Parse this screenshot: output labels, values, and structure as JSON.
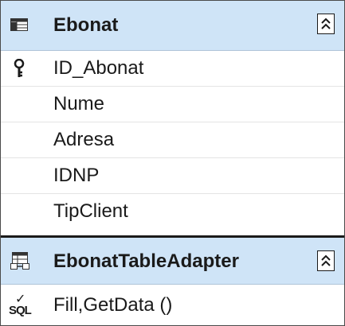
{
  "table": {
    "title": "Ebonat",
    "icon": "table-icon",
    "collapse_icon": "chevron-double-up-icon",
    "columns": [
      {
        "name": "ID_Abonat",
        "primary_key": true
      },
      {
        "name": "Nume",
        "primary_key": false
      },
      {
        "name": "Adresa",
        "primary_key": false
      },
      {
        "name": "IDNP",
        "primary_key": false
      },
      {
        "name": "TipClient",
        "primary_key": false
      }
    ]
  },
  "adapter": {
    "title": "EbonatTableAdapter",
    "icon": "table-adapter-icon",
    "collapse_icon": "chevron-double-up-icon",
    "methods": [
      {
        "label": "Fill,GetData ()",
        "icon": "sql-query-icon"
      }
    ]
  },
  "colors": {
    "header_bg": "#cfe4f7",
    "border": "#4a4a4a",
    "text": "#1a1a1a"
  }
}
